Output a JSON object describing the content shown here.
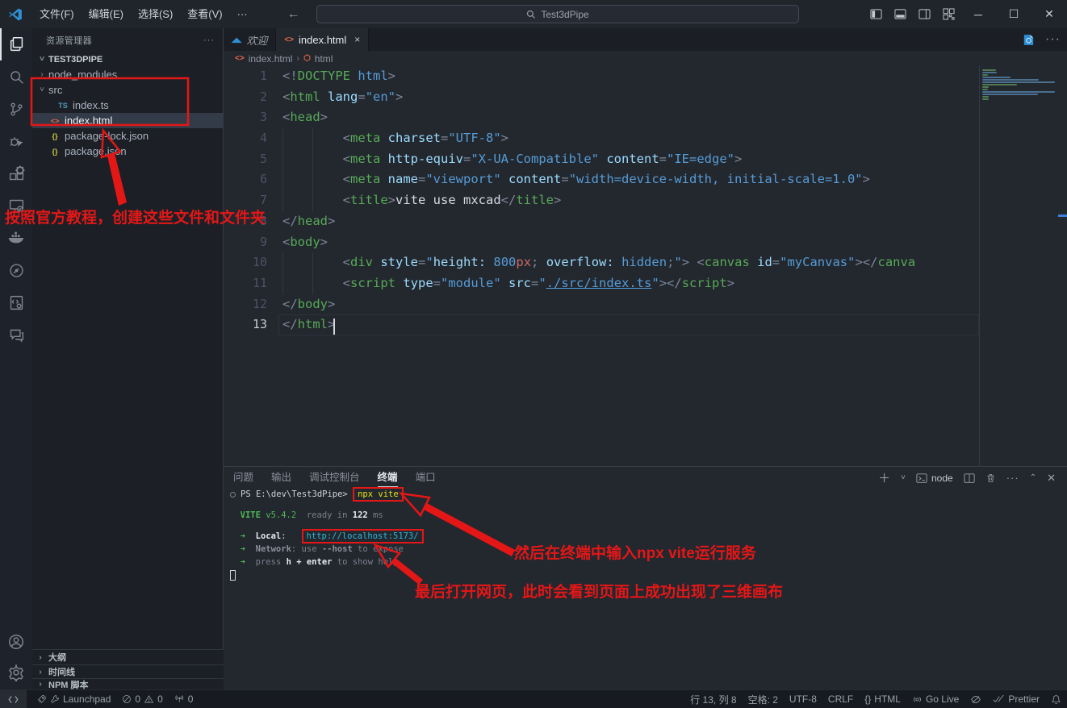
{
  "colors": {
    "annotation_red": "#e41717",
    "accent_blue": "#3b82d8",
    "tab_orange": "#e8694a",
    "ts_blue": "#519aba",
    "json_yellow": "#cbcb41"
  },
  "title_bar": {
    "menus": [
      "文件(F)",
      "编辑(E)",
      "选择(S)",
      "查看(V)",
      "···"
    ],
    "search_value": "Test3dPipe"
  },
  "activity_bar": {
    "icons": [
      "explorer-icon",
      "search-icon",
      "source-control-icon",
      "run-debug-icon",
      "extensions-icon",
      "remote-explorer-icon",
      "docker-icon",
      "history-circle-icon",
      "file-settings-icon",
      "comments-icon",
      "account-icon",
      "settings-gear-icon"
    ]
  },
  "explorer": {
    "header": "资源管理器",
    "tree": [
      {
        "chev": "˅",
        "icon": "",
        "label": "TEST3DPIPE",
        "indent": 0,
        "root": true,
        "selected": false
      },
      {
        "chev": "›",
        "icon": "",
        "label": "node_modules",
        "indent": 1,
        "root": false,
        "selected": false
      },
      {
        "chev": "˅",
        "icon": "",
        "label": "src",
        "indent": 1,
        "root": false,
        "selected": false
      },
      {
        "chev": "",
        "icon": "TS",
        "label": "index.ts",
        "indent": 2,
        "root": false,
        "selected": false
      },
      {
        "chev": "",
        "icon": "<>",
        "label": "index.html",
        "indent": 1,
        "root": false,
        "selected": true
      },
      {
        "chev": "",
        "icon": "{}",
        "label": "package-lock.json",
        "indent": 1,
        "root": false,
        "selected": false
      },
      {
        "chev": "",
        "icon": "{}",
        "label": "package.json",
        "indent": 1,
        "root": false,
        "selected": false
      }
    ],
    "bottom_sections": [
      "大纲",
      "时间线",
      "NPM 脚本"
    ]
  },
  "tabs": [
    {
      "label": "欢迎",
      "icon": "vscode-logo-icon",
      "active": false,
      "preview": true,
      "close": ""
    },
    {
      "label": "index.html",
      "icon": "html-icon",
      "active": true,
      "preview": false,
      "close": "×"
    }
  ],
  "breadcrumb": {
    "file": "index.html",
    "node": "html"
  },
  "editor": {
    "lines": [
      {
        "n": "1",
        "g": false,
        "cur": false,
        "toks": [
          [
            "<!",
            "p"
          ],
          [
            "DOCTYPE",
            "tag"
          ],
          [
            " ",
            "p"
          ],
          [
            "html",
            "kw"
          ],
          [
            ">",
            "p"
          ]
        ]
      },
      {
        "n": "2",
        "g": false,
        "cur": false,
        "toks": [
          [
            "<",
            "p"
          ],
          [
            "html",
            "tag"
          ],
          [
            " ",
            "p"
          ],
          [
            "lang",
            "attr"
          ],
          [
            "=",
            "p"
          ],
          [
            "\"en\"",
            "str"
          ],
          [
            ">",
            "p"
          ]
        ]
      },
      {
        "n": "3",
        "g": false,
        "cur": false,
        "toks": [
          [
            "<",
            "p"
          ],
          [
            "head",
            "tag"
          ],
          [
            ">",
            "p"
          ]
        ]
      },
      {
        "n": "4",
        "g": true,
        "cur": false,
        "toks": [
          [
            "        ",
            "p"
          ],
          [
            "<",
            "p"
          ],
          [
            "meta",
            "tag"
          ],
          [
            " ",
            "p"
          ],
          [
            "charset",
            "attr"
          ],
          [
            "=",
            "p"
          ],
          [
            "\"UTF-8\"",
            "str"
          ],
          [
            ">",
            "p"
          ]
        ]
      },
      {
        "n": "5",
        "g": true,
        "cur": false,
        "toks": [
          [
            "        ",
            "p"
          ],
          [
            "<",
            "p"
          ],
          [
            "meta",
            "tag"
          ],
          [
            " ",
            "p"
          ],
          [
            "http-equiv",
            "attr"
          ],
          [
            "=",
            "p"
          ],
          [
            "\"X-UA-Compatible\"",
            "str"
          ],
          [
            " ",
            "p"
          ],
          [
            "content",
            "attr"
          ],
          [
            "=",
            "p"
          ],
          [
            "\"IE=edge\"",
            "str"
          ],
          [
            ">",
            "p"
          ]
        ]
      },
      {
        "n": "6",
        "g": true,
        "cur": false,
        "toks": [
          [
            "        ",
            "p"
          ],
          [
            "<",
            "p"
          ],
          [
            "meta",
            "tag"
          ],
          [
            " ",
            "p"
          ],
          [
            "name",
            "attr"
          ],
          [
            "=",
            "p"
          ],
          [
            "\"viewport\"",
            "str"
          ],
          [
            " ",
            "p"
          ],
          [
            "content",
            "attr"
          ],
          [
            "=",
            "p"
          ],
          [
            "\"width=device-width, initial-scale=1.0\"",
            "str"
          ],
          [
            ">",
            "p"
          ]
        ]
      },
      {
        "n": "7",
        "g": true,
        "cur": false,
        "toks": [
          [
            "        ",
            "p"
          ],
          [
            "<",
            "p"
          ],
          [
            "title",
            "tag"
          ],
          [
            ">",
            "p"
          ],
          [
            "vite use mxcad",
            "txt"
          ],
          [
            "</",
            "p"
          ],
          [
            "title",
            "tag"
          ],
          [
            ">",
            "p"
          ]
        ]
      },
      {
        "n": "8",
        "g": false,
        "cur": false,
        "toks": [
          [
            "</",
            "p"
          ],
          [
            "head",
            "tag"
          ],
          [
            ">",
            "p"
          ]
        ]
      },
      {
        "n": "9",
        "g": false,
        "cur": false,
        "toks": [
          [
            "<",
            "p"
          ],
          [
            "body",
            "tag"
          ],
          [
            ">",
            "p"
          ]
        ]
      },
      {
        "n": "10",
        "g": true,
        "cur": false,
        "toks": [
          [
            "        ",
            "p"
          ],
          [
            "<",
            "p"
          ],
          [
            "div",
            "tag"
          ],
          [
            " ",
            "p"
          ],
          [
            "style",
            "attr"
          ],
          [
            "=",
            "p"
          ],
          [
            "\"",
            "str"
          ],
          [
            "height:",
            "attr"
          ],
          [
            " ",
            "p"
          ],
          [
            "800",
            "kw"
          ],
          [
            "px",
            "unit"
          ],
          [
            "; ",
            "p"
          ],
          [
            "overflow:",
            "attr"
          ],
          [
            " ",
            "p"
          ],
          [
            "hidden",
            "kw"
          ],
          [
            ";",
            "p"
          ],
          [
            "\"",
            "str"
          ],
          [
            ">",
            "p"
          ],
          [
            " ",
            "p"
          ],
          [
            "<",
            "p"
          ],
          [
            "canvas",
            "tag"
          ],
          [
            " ",
            "p"
          ],
          [
            "id",
            "attr"
          ],
          [
            "=",
            "p"
          ],
          [
            "\"myCanvas\"",
            "str"
          ],
          [
            ">",
            "p"
          ],
          [
            "</",
            "p"
          ],
          [
            "canva",
            "tag"
          ]
        ]
      },
      {
        "n": "11",
        "g": true,
        "cur": false,
        "toks": [
          [
            "        ",
            "p"
          ],
          [
            "<",
            "p"
          ],
          [
            "script",
            "tag"
          ],
          [
            " ",
            "p"
          ],
          [
            "type",
            "attr"
          ],
          [
            "=",
            "p"
          ],
          [
            "\"module\"",
            "str"
          ],
          [
            " ",
            "p"
          ],
          [
            "src",
            "attr"
          ],
          [
            "=",
            "p"
          ],
          [
            "\"",
            "str"
          ],
          [
            "./src/index.ts",
            "lnk"
          ],
          [
            "\"",
            "str"
          ],
          [
            ">",
            "p"
          ],
          [
            "</",
            "p"
          ],
          [
            "script",
            "tag"
          ],
          [
            ">",
            "p"
          ]
        ]
      },
      {
        "n": "12",
        "g": false,
        "cur": false,
        "toks": [
          [
            "</",
            "p"
          ],
          [
            "body",
            "tag"
          ],
          [
            ">",
            "p"
          ]
        ]
      },
      {
        "n": "13",
        "g": false,
        "cur": true,
        "toks": [
          [
            "</",
            "p"
          ],
          [
            "html",
            "tag"
          ],
          [
            ">",
            "p"
          ]
        ]
      }
    ]
  },
  "panel": {
    "tabs": [
      "问题",
      "输出",
      "调试控制台",
      "终端",
      "端口"
    ],
    "active_tab": "终端",
    "toolbar": {
      "shell_label": "node"
    },
    "terminal_lines": [
      {
        "gap": false,
        "toks": [
          [
            "",
            "cir"
          ],
          [
            "PS E:\\dev\\Test3dPipe>",
            "fg"
          ],
          [
            " ",
            "fg"
          ],
          [
            "npx vite",
            "yel rbox"
          ]
        ]
      },
      {
        "gap": true,
        "toks": []
      },
      {
        "gap": false,
        "toks": [
          [
            "  ",
            "fg"
          ],
          [
            "VITE",
            "grnb"
          ],
          [
            " v5.4.2",
            "grn"
          ],
          [
            "  ready in ",
            "dim"
          ],
          [
            "122",
            "fgb"
          ],
          [
            " ms",
            "dim"
          ]
        ]
      },
      {
        "gap": true,
        "toks": []
      },
      {
        "gap": false,
        "toks": [
          [
            "  ",
            "fg"
          ],
          [
            "➜",
            "grn"
          ],
          [
            "  ",
            "dim"
          ],
          [
            "Local",
            "fgb"
          ],
          [
            ":   ",
            "fg"
          ],
          [
            "http://localhost:5173/",
            "cyn rbox"
          ]
        ]
      },
      {
        "gap": false,
        "toks": [
          [
            "  ",
            "fg"
          ],
          [
            "➜",
            "grn"
          ],
          [
            "  ",
            "dim"
          ],
          [
            "Network",
            "dimb"
          ],
          [
            ": use ",
            "dim"
          ],
          [
            "--host",
            "dimb"
          ],
          [
            " to expose",
            "dim"
          ]
        ]
      },
      {
        "gap": false,
        "toks": [
          [
            "  ",
            "fg"
          ],
          [
            "➜",
            "grn"
          ],
          [
            "  ",
            "dim"
          ],
          [
            "press ",
            "dim"
          ],
          [
            "h + enter",
            "fgb"
          ],
          [
            " to show help",
            "dim"
          ]
        ]
      },
      {
        "gap": false,
        "toks": [
          [
            "",
            "tcursor"
          ]
        ]
      }
    ]
  },
  "status_bar": {
    "launchpad": "Launchpad",
    "errors": "0",
    "warnings": "0",
    "feedback_count": "0",
    "cursor_pos": "行 13, 列 8",
    "indent": "空格: 2",
    "encoding": "UTF-8",
    "eol": "CRLF",
    "lang_icon": "{}",
    "language": "HTML",
    "go_live": "Go Live",
    "prettier": "Prettier"
  },
  "annotations": {
    "note_files": "按照官方教程，创建这些文件和文件夹",
    "note_terminal": "然后在终端中输入npx vite运行服务",
    "note_browser": "最后打开网页，此时会看到页面上成功出现了三维画布"
  }
}
